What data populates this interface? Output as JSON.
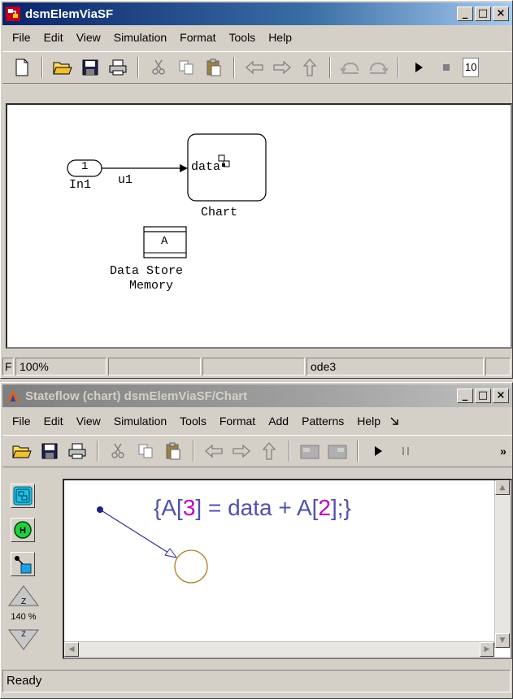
{
  "simulink": {
    "title": "dsmElemViaSF",
    "title_buttons": [
      "_",
      "□",
      "×"
    ],
    "menu": [
      "File",
      "Edit",
      "View",
      "Simulation",
      "Format",
      "Tools",
      "Help"
    ],
    "toolbar_input": "10",
    "blocks": {
      "inport_number": "1",
      "inport_label": "In1",
      "signal_label": "u1",
      "chart_port_label": "data",
      "chart_label": "Chart",
      "dsm_value": "A",
      "dsm_label_line1": "Data Store",
      "dsm_label_line2": "Memory"
    },
    "status": {
      "first": "F",
      "zoom": "100%",
      "solver": "ode3"
    }
  },
  "stateflow": {
    "title": "Stateflow (chart) dsmElemViaSF/Chart",
    "title_buttons": [
      "_",
      "□",
      "×"
    ],
    "menu": [
      "File",
      "Edit",
      "View",
      "Simulation",
      "Tools",
      "Format",
      "Add",
      "Patterns",
      "Help"
    ],
    "overflow_glyph": "»",
    "zoom_label": "140 %",
    "action_parts": [
      "{A[",
      "3",
      "] = data + A[",
      "2",
      "];}"
    ],
    "status_text": "Ready"
  },
  "colors": {
    "title_active": "#0a246a",
    "action_text": "#5050b0",
    "index_magenta": "#c000c0",
    "transition_line": "#3030a0",
    "junction_stroke": "#b08020",
    "chart_block_fill": "#ffffff"
  }
}
